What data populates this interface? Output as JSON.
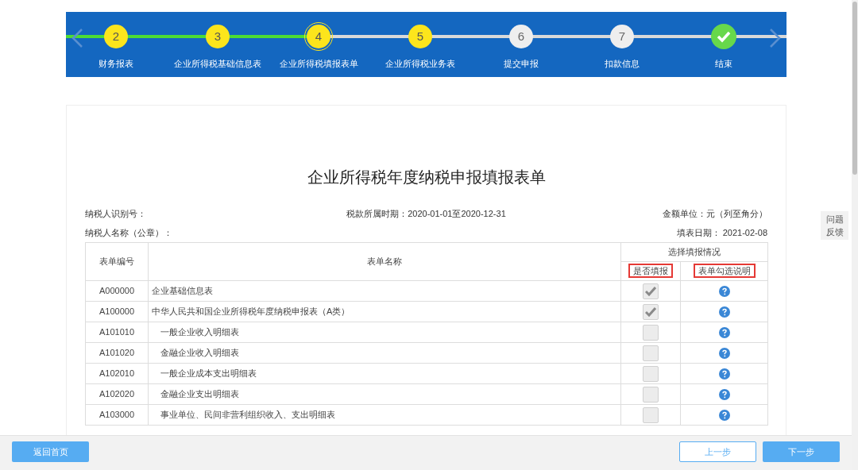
{
  "steps": [
    {
      "kind": "number",
      "number": "2",
      "label": "财务报表",
      "completed": true,
      "selected": false
    },
    {
      "kind": "number",
      "number": "3",
      "label": "企业所得税基础信息表",
      "completed": true,
      "selected": false
    },
    {
      "kind": "number",
      "number": "4",
      "label": "企业所得税填报表单",
      "completed": true,
      "selected": true
    },
    {
      "kind": "number",
      "number": "5",
      "label": "企业所得税业务表",
      "completed": true,
      "selected": false
    },
    {
      "kind": "number",
      "number": "6",
      "label": "提交申报",
      "completed": false,
      "selected": false
    },
    {
      "kind": "number",
      "number": "7",
      "label": "扣款信息",
      "completed": false,
      "selected": false
    },
    {
      "kind": "end",
      "label": "结束",
      "completed": false,
      "selected": false
    }
  ],
  "form": {
    "title": "企业所得税年度纳税申报填报表单",
    "taxpayer_id_label": "纳税人识别号：",
    "period": "税款所属时期：2020-01-01至2020-12-31",
    "unit": "金额单位：元（列至角分）",
    "taxpayer_name_label": "纳税人名称（公章）：",
    "fill_date": "填表日期： 2021-02-08"
  },
  "table": {
    "columns": [
      {
        "label": "表单编号"
      },
      {
        "label": "表单名称"
      },
      {
        "label": "选择填报情况"
      }
    ],
    "subcolumns": [
      {
        "label": "是否填报",
        "highlighted": true
      },
      {
        "label": "表单勾选说明",
        "highlighted": true
      }
    ],
    "rows": [
      {
        "code": "A000000",
        "name": "企业基础信息表",
        "checked": true
      },
      {
        "code": "A100000",
        "name": "中华人民共和国企业所得税年度纳税申报表（A类）",
        "checked": true,
        "children": [
          {
            "code": "A101010",
            "name": "一般企业收入明细表",
            "checked": false
          },
          {
            "code": "A101020",
            "name": "金融企业收入明细表",
            "checked": false
          },
          {
            "code": "A102010",
            "name": "一般企业成本支出明细表",
            "checked": false
          },
          {
            "code": "A102020",
            "name": "金融企业支出明细表",
            "checked": false
          },
          {
            "code": "A103000",
            "name": "事业单位、民间非营利组织收入、支出明细表",
            "checked": false
          }
        ]
      }
    ]
  },
  "feedback": "问题反馈",
  "buttons": {
    "home": "返回首页",
    "prev": "上一步",
    "next": "下一步"
  }
}
